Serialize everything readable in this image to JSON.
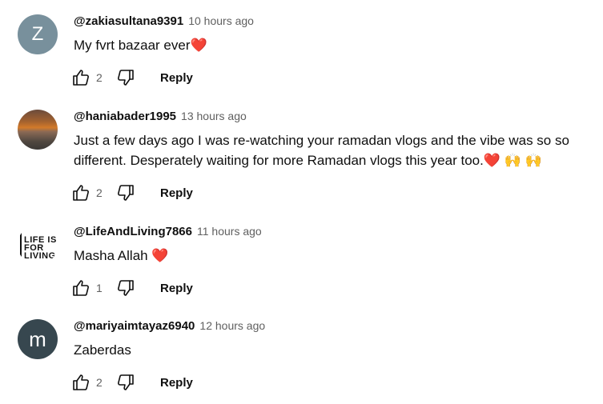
{
  "comments": [
    {
      "handle": "@zakiasultana9391",
      "time": "10 hours ago",
      "avatar_letter": "Z",
      "text": "My fvrt bazaar ever",
      "emoji": "❤️",
      "likes": "2",
      "reply": "Reply"
    },
    {
      "handle": "@haniabader1995",
      "time": "13 hours ago",
      "text_line1": "Just a few days ago I was re-watching your ramadan vlogs and the vibe was so so",
      "text_line2": "different. Desperately waiting for more Ramadan vlogs this year too.",
      "emoji": "❤️",
      "emoji2": "🙌 🙌",
      "likes": "2",
      "reply": "Reply"
    },
    {
      "handle": "@LifeAndLiving7866",
      "time": "11 hours ago",
      "avatar_logo_lines": [
        "LIFE IS",
        "FOR",
        "LIVING"
      ],
      "text": "Masha Allah",
      "emoji": "❤️",
      "likes": "1",
      "reply": "Reply"
    },
    {
      "handle": "@mariyaimtayaz6940",
      "time": "12 hours ago",
      "avatar_letter": "m",
      "text": "Zaberdas",
      "likes": "2",
      "reply": "Reply"
    }
  ],
  "icons": {
    "like": "thumbs-up-icon",
    "dislike": "thumbs-down-icon"
  },
  "colors": {
    "avatar_z": "#78909c",
    "avatar_m": "#37474f",
    "meta_text": "#606060",
    "heart": "#e0245e"
  }
}
